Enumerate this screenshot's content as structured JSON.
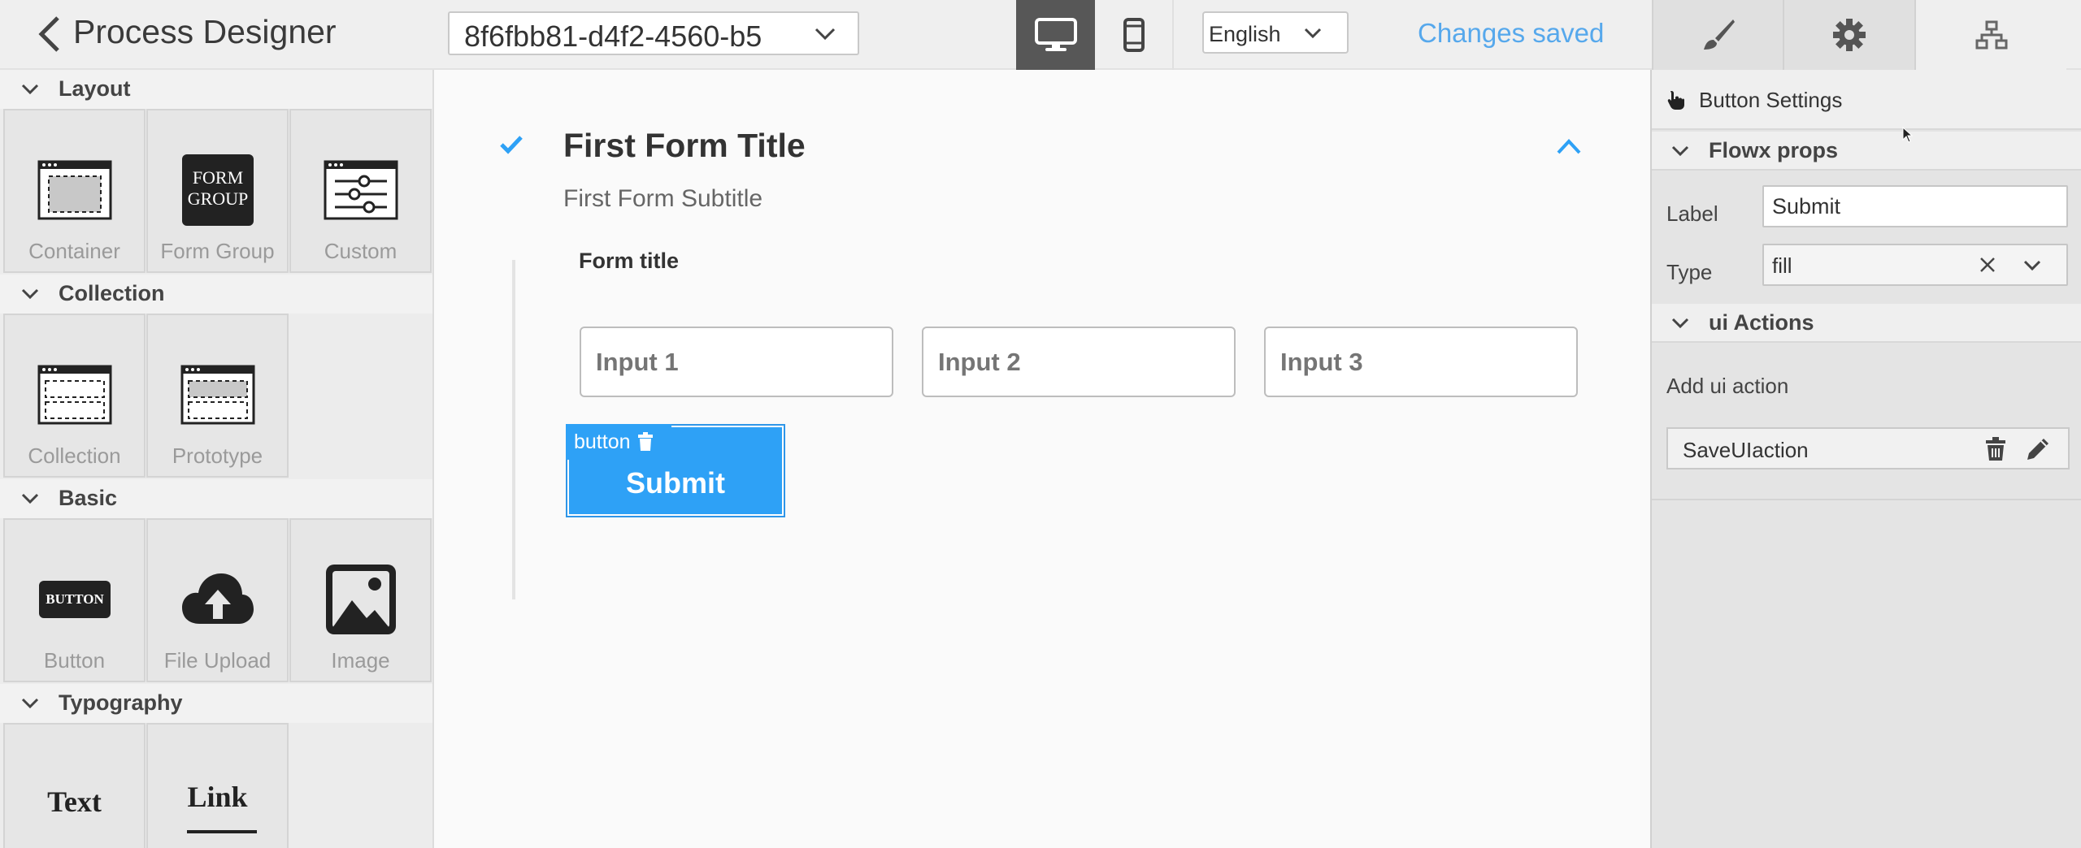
{
  "header": {
    "back_icon": "chevron-left-icon",
    "title": "Process Designer",
    "process_select_value": "8f6fbb81-d4f2-4560-b5",
    "view_modes": [
      "desktop-icon",
      "mobile-icon"
    ],
    "language": "English",
    "status": "Changes saved",
    "panel_tabs": [
      "brush-icon",
      "gear-icon",
      "sitemap-icon"
    ]
  },
  "palette": {
    "sections": [
      {
        "name": "Layout",
        "items": [
          {
            "label": "Container"
          },
          {
            "label": "Form Group",
            "glyph": "FORM GROUP"
          },
          {
            "label": "Custom"
          }
        ]
      },
      {
        "name": "Collection",
        "items": [
          {
            "label": "Collection"
          },
          {
            "label": "Prototype"
          }
        ]
      },
      {
        "name": "Basic",
        "items": [
          {
            "label": "Button",
            "glyph": "BUTTON"
          },
          {
            "label": "File Upload"
          },
          {
            "label": "Image"
          }
        ]
      },
      {
        "name": "Typography",
        "items": [
          {
            "glyph": "Text"
          },
          {
            "glyph": "Link"
          }
        ]
      }
    ]
  },
  "canvas": {
    "form_title": "First Form Title",
    "form_subtitle": "First Form Subtitle",
    "group_title": "Form title",
    "inputs": [
      {
        "placeholder": "Input 1"
      },
      {
        "placeholder": "Input 2"
      },
      {
        "placeholder": "Input 3"
      }
    ],
    "button_tag": "button",
    "button_label": "Submit",
    "accent_color": "#2ea1f6"
  },
  "properties": {
    "header": "Button Settings",
    "groups": [
      {
        "name": "Flowx props"
      },
      {
        "name": "ui Actions"
      }
    ],
    "label_field": {
      "label": "Label",
      "value": "Submit"
    },
    "type_field": {
      "label": "Type",
      "value": "fill"
    },
    "add_action": "Add ui action",
    "actions": [
      {
        "name": "SaveUIaction"
      }
    ]
  }
}
